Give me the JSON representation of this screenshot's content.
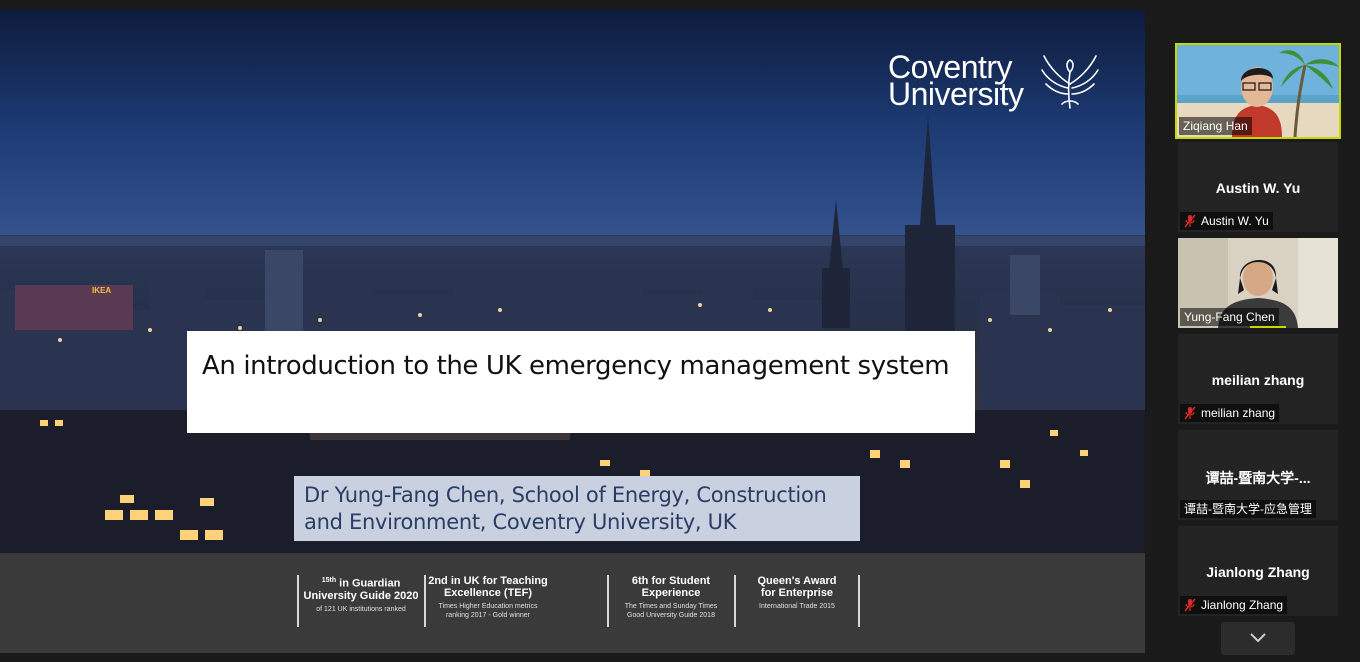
{
  "slide": {
    "logo": {
      "line1": "Coventry",
      "line2": "University"
    },
    "title": "An introduction to the UK emergency management system",
    "subtitle_line1": "Dr Yung-Fang Chen, School of Energy, Construction",
    "subtitle_line2": "and Environment, Coventry University, UK",
    "billboard": "IKEA",
    "awards": [
      {
        "head_sup": "15th",
        "head": "in Guardian",
        "head2": "University Guide 2020",
        "sub1": "of 121 UK institutions ranked",
        "sub2": ""
      },
      {
        "head_sup": "",
        "head": "2nd in UK for Teaching",
        "head2": "Excellence (TEF)",
        "sub1": "Times Higher Education metrics",
        "sub2": "ranking 2017 - Gold winner"
      },
      {
        "head_sup": "6th",
        "head": "for Student",
        "head2": "Experience",
        "sub1": "The Times and Sunday Times",
        "sub2": "Good University Guide 2018"
      },
      {
        "head_sup": "",
        "head": "Queen's Award",
        "head2": "for Enterprise",
        "sub1": "International Trade 2015",
        "sub2": ""
      }
    ]
  },
  "participants": [
    {
      "name": "Ziqiang Han",
      "video": true,
      "muted": false,
      "speaking": true
    },
    {
      "name": "Austin W. Yu",
      "display_name": "Austin W. Yu",
      "video": false,
      "muted": true
    },
    {
      "name": "Yung-Fang Chen",
      "video": true,
      "muted": false,
      "speaking": true
    },
    {
      "name": "meilian zhang",
      "display_name": "meilian zhang",
      "video": false,
      "muted": true
    },
    {
      "name": "谭喆-暨南大学-应急管理",
      "display_name": "谭喆-暨南大学-...",
      "video": false,
      "muted": false
    },
    {
      "name": "Jianlong Zhang",
      "display_name": "Jianlong Zhang",
      "video": false,
      "muted": true
    }
  ],
  "colors": {
    "speaking_border": "#c4d800",
    "mute_red": "#e02828",
    "panel_bg": "#1a1a1a",
    "tile_bg": "#232323"
  }
}
